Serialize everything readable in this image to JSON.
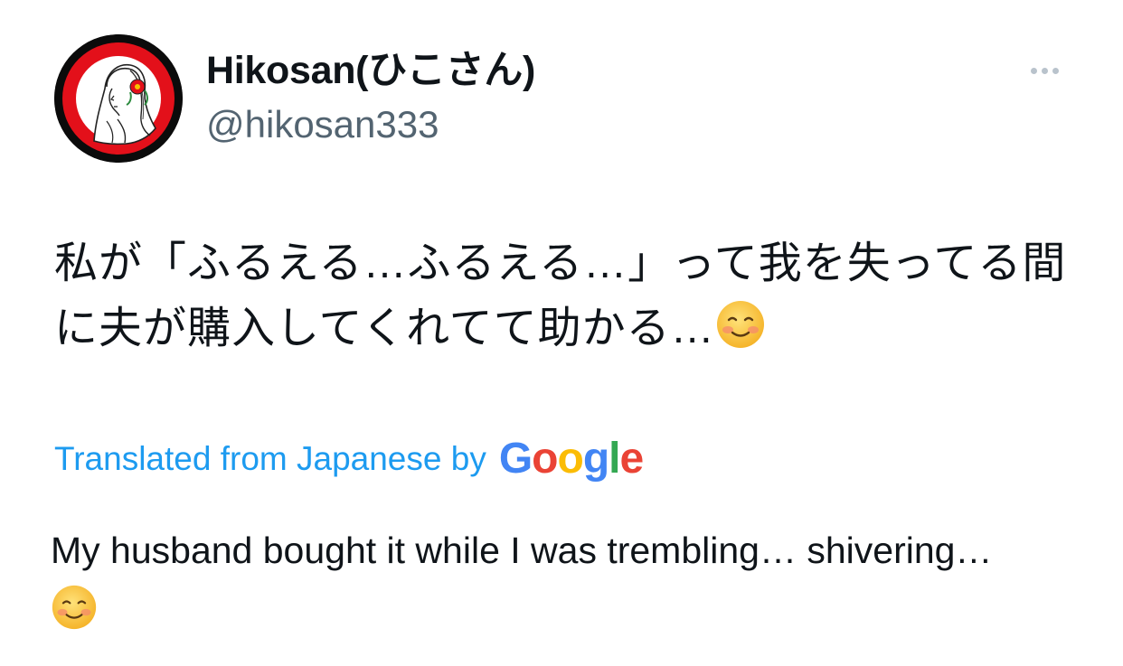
{
  "author": {
    "display_name": "Hikosan(ひこさん)",
    "handle": "@hikosan333",
    "avatar_icon": "avatar-illustration-icon"
  },
  "menu": {
    "icon": "more-dots-icon"
  },
  "tweet": {
    "text": "私が「ふるえる…ふるえる…」って我を失ってる間に夫が購入してくれてて助かる…",
    "emoji": "smiling-face-icon"
  },
  "translation": {
    "label": "Translated from Japanese by",
    "provider_letters": [
      "G",
      "o",
      "o",
      "g",
      "l",
      "e"
    ],
    "text": "My husband bought it while I was trembling… shivering…",
    "emoji": "smiling-face-icon"
  },
  "colors": {
    "link": "#1d9bf0",
    "handle": "#536471",
    "text": "#0f1419",
    "avatar_ring": "#e3101a"
  }
}
